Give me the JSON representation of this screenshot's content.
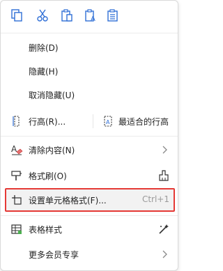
{
  "toolbar": {
    "icons": [
      "copy-icon",
      "cut-icon",
      "paste-icon",
      "paste-text-icon",
      "paste-special-icon"
    ]
  },
  "menu": {
    "delete": "删除(D)",
    "hide": "隐藏(H)",
    "unhide": "取消隐藏(U)",
    "row_height": "行高(R)...",
    "best_fit_row_height": "最适合的行高",
    "clear_content": "清除内容(N)",
    "format_painter": "格式刷(O)",
    "format_cells": "设置单元格格式(F)...",
    "format_cells_shortcut": "Ctrl+1",
    "table_style": "表格样式",
    "more_member": "更多会员专享"
  },
  "colors": {
    "accent": "#2f6fd6",
    "highlight_border": "#e53935",
    "hover_bg": "#f2f2f2"
  }
}
